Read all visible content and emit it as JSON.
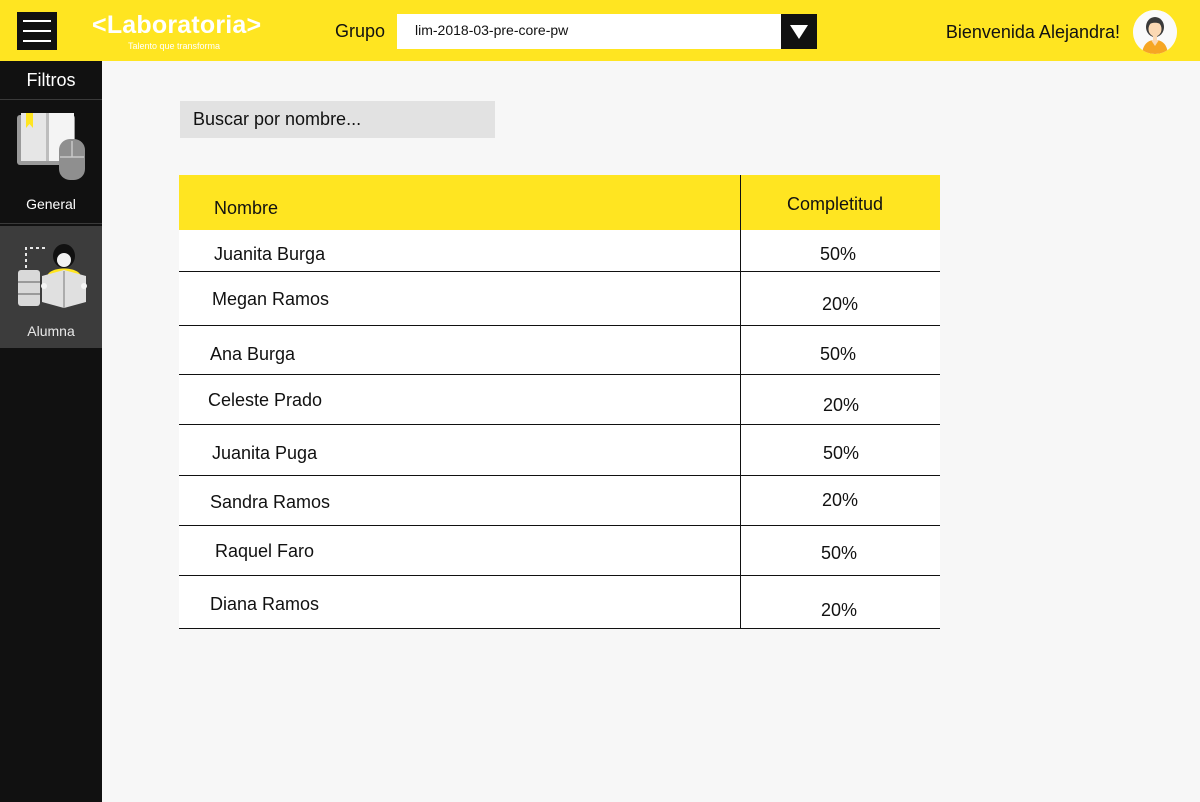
{
  "header": {
    "logo_text": "Laboratoria",
    "logo_tagline": "Talento que transforma",
    "group_label": "Grupo",
    "group_selected": "lim-2018-03-pre-core-pw",
    "welcome": "Bienvenida Alejandra!",
    "brand_color": "#ffe521"
  },
  "sidebar": {
    "title": "Filtros",
    "items": [
      {
        "label": "General",
        "icon": "book-mouse-icon",
        "active": false
      },
      {
        "label": "Alumna",
        "icon": "student-icon",
        "active": true
      }
    ]
  },
  "search": {
    "placeholder": "Buscar por nombre..."
  },
  "table": {
    "columns": [
      "Nombre",
      "Completitud"
    ],
    "rows": [
      {
        "name": "Juanita Burga",
        "completion": "50%"
      },
      {
        "name": "Megan Ramos",
        "completion": "20%"
      },
      {
        "name": "Ana Burga",
        "completion": "50%"
      },
      {
        "name": "Celeste Prado",
        "completion": "20%"
      },
      {
        "name": "Juanita Puga",
        "completion": "50%"
      },
      {
        "name": "Sandra Ramos",
        "completion": "20%"
      },
      {
        "name": "Raquel Faro",
        "completion": "50%"
      },
      {
        "name": "Diana Ramos",
        "completion": "20%"
      }
    ]
  }
}
